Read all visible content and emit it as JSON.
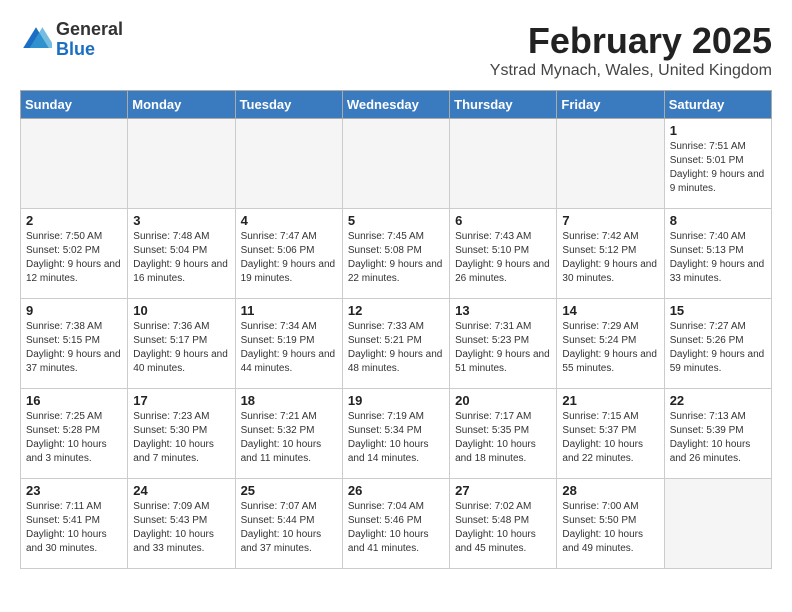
{
  "logo": {
    "general": "General",
    "blue": "Blue"
  },
  "title": {
    "month_year": "February 2025",
    "location": "Ystrad Mynach, Wales, United Kingdom"
  },
  "headers": [
    "Sunday",
    "Monday",
    "Tuesday",
    "Wednesday",
    "Thursday",
    "Friday",
    "Saturday"
  ],
  "weeks": [
    [
      {
        "day": "",
        "info": ""
      },
      {
        "day": "",
        "info": ""
      },
      {
        "day": "",
        "info": ""
      },
      {
        "day": "",
        "info": ""
      },
      {
        "day": "",
        "info": ""
      },
      {
        "day": "",
        "info": ""
      },
      {
        "day": "1",
        "info": "Sunrise: 7:51 AM\nSunset: 5:01 PM\nDaylight: 9 hours and 9 minutes."
      }
    ],
    [
      {
        "day": "2",
        "info": "Sunrise: 7:50 AM\nSunset: 5:02 PM\nDaylight: 9 hours and 12 minutes."
      },
      {
        "day": "3",
        "info": "Sunrise: 7:48 AM\nSunset: 5:04 PM\nDaylight: 9 hours and 16 minutes."
      },
      {
        "day": "4",
        "info": "Sunrise: 7:47 AM\nSunset: 5:06 PM\nDaylight: 9 hours and 19 minutes."
      },
      {
        "day": "5",
        "info": "Sunrise: 7:45 AM\nSunset: 5:08 PM\nDaylight: 9 hours and 22 minutes."
      },
      {
        "day": "6",
        "info": "Sunrise: 7:43 AM\nSunset: 5:10 PM\nDaylight: 9 hours and 26 minutes."
      },
      {
        "day": "7",
        "info": "Sunrise: 7:42 AM\nSunset: 5:12 PM\nDaylight: 9 hours and 30 minutes."
      },
      {
        "day": "8",
        "info": "Sunrise: 7:40 AM\nSunset: 5:13 PM\nDaylight: 9 hours and 33 minutes."
      }
    ],
    [
      {
        "day": "9",
        "info": "Sunrise: 7:38 AM\nSunset: 5:15 PM\nDaylight: 9 hours and 37 minutes."
      },
      {
        "day": "10",
        "info": "Sunrise: 7:36 AM\nSunset: 5:17 PM\nDaylight: 9 hours and 40 minutes."
      },
      {
        "day": "11",
        "info": "Sunrise: 7:34 AM\nSunset: 5:19 PM\nDaylight: 9 hours and 44 minutes."
      },
      {
        "day": "12",
        "info": "Sunrise: 7:33 AM\nSunset: 5:21 PM\nDaylight: 9 hours and 48 minutes."
      },
      {
        "day": "13",
        "info": "Sunrise: 7:31 AM\nSunset: 5:23 PM\nDaylight: 9 hours and 51 minutes."
      },
      {
        "day": "14",
        "info": "Sunrise: 7:29 AM\nSunset: 5:24 PM\nDaylight: 9 hours and 55 minutes."
      },
      {
        "day": "15",
        "info": "Sunrise: 7:27 AM\nSunset: 5:26 PM\nDaylight: 9 hours and 59 minutes."
      }
    ],
    [
      {
        "day": "16",
        "info": "Sunrise: 7:25 AM\nSunset: 5:28 PM\nDaylight: 10 hours and 3 minutes."
      },
      {
        "day": "17",
        "info": "Sunrise: 7:23 AM\nSunset: 5:30 PM\nDaylight: 10 hours and 7 minutes."
      },
      {
        "day": "18",
        "info": "Sunrise: 7:21 AM\nSunset: 5:32 PM\nDaylight: 10 hours and 11 minutes."
      },
      {
        "day": "19",
        "info": "Sunrise: 7:19 AM\nSunset: 5:34 PM\nDaylight: 10 hours and 14 minutes."
      },
      {
        "day": "20",
        "info": "Sunrise: 7:17 AM\nSunset: 5:35 PM\nDaylight: 10 hours and 18 minutes."
      },
      {
        "day": "21",
        "info": "Sunrise: 7:15 AM\nSunset: 5:37 PM\nDaylight: 10 hours and 22 minutes."
      },
      {
        "day": "22",
        "info": "Sunrise: 7:13 AM\nSunset: 5:39 PM\nDaylight: 10 hours and 26 minutes."
      }
    ],
    [
      {
        "day": "23",
        "info": "Sunrise: 7:11 AM\nSunset: 5:41 PM\nDaylight: 10 hours and 30 minutes."
      },
      {
        "day": "24",
        "info": "Sunrise: 7:09 AM\nSunset: 5:43 PM\nDaylight: 10 hours and 33 minutes."
      },
      {
        "day": "25",
        "info": "Sunrise: 7:07 AM\nSunset: 5:44 PM\nDaylight: 10 hours and 37 minutes."
      },
      {
        "day": "26",
        "info": "Sunrise: 7:04 AM\nSunset: 5:46 PM\nDaylight: 10 hours and 41 minutes."
      },
      {
        "day": "27",
        "info": "Sunrise: 7:02 AM\nSunset: 5:48 PM\nDaylight: 10 hours and 45 minutes."
      },
      {
        "day": "28",
        "info": "Sunrise: 7:00 AM\nSunset: 5:50 PM\nDaylight: 10 hours and 49 minutes."
      },
      {
        "day": "",
        "info": ""
      }
    ]
  ]
}
